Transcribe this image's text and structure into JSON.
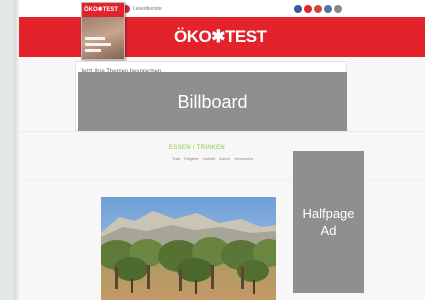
{
  "topbar": {
    "link_text": "Leserdienste",
    "social_colors": [
      "#3b5998",
      "#e3222c",
      "#d34836",
      "#4c75a3",
      "#888888"
    ]
  },
  "brand": {
    "logo_text": "ÖKO✱TEST",
    "accent": "#e3222c"
  },
  "magazine": {
    "title": "ÖKO✱TEST"
  },
  "panel": {
    "heading": "Jetzt Ihre Themen besprechen"
  },
  "ads": {
    "billboard_label": "Billboard",
    "halfpage_label": "Halfpage Ad"
  },
  "section": {
    "title": "ESSEN / TRINKEN",
    "title_color": "#8cc63e",
    "links": [
      "Tests",
      "Ratgeber",
      "Kindheit",
      "Bücher",
      "Verbraucher"
    ]
  }
}
